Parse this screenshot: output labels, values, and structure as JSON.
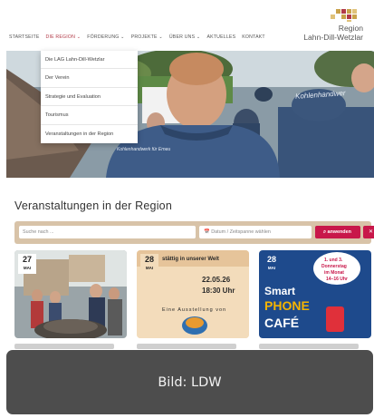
{
  "nav": {
    "items": [
      {
        "label": "STARTSEITE"
      },
      {
        "label": "DIE REGION ⌄"
      },
      {
        "label": "FÖRDERUNG ⌄"
      },
      {
        "label": "PROJEKTE ⌄"
      },
      {
        "label": "ÜBER UNS ⌄"
      },
      {
        "label": "AKTUELLES"
      },
      {
        "label": "KONTAKT"
      }
    ],
    "active": "DIE REGION",
    "accent_color": "#b23a48"
  },
  "logo": {
    "line1": "Region",
    "line2": "Lahn-Dill-Wetzlar"
  },
  "dropdown": {
    "items": [
      "Die LAG Lahn-Dill-Wetzlar",
      "Der Verein",
      "Strategie und Evaluation",
      "Tourismus",
      "Veranstaltungen in der Region"
    ]
  },
  "hero": {
    "jacket_text_1": "Kohlenhandwer",
    "jacket_text_2": "Kohlenhandwerk für Erneu"
  },
  "section": {
    "title": "Veranstaltungen in der Region"
  },
  "search": {
    "placeholder": "Suche nach ...",
    "date_placeholder": "📅 Datum / Zeitspanne wählen",
    "apply_label": "⌕ anwenden",
    "close_label": "✕",
    "bar_color": "#d8c3a8",
    "button_color": "#c8174a"
  },
  "cards": [
    {
      "day": "27",
      "month": "MAI"
    },
    {
      "day": "28",
      "month": "MAI",
      "poster": {
        "headline": "stättig in unserer Welt",
        "date": "22.05.26",
        "time": "18:30 Uhr",
        "footer": "Eine Ausstellung von"
      }
    },
    {
      "day": "28",
      "month": "MAI",
      "poster": {
        "word1": "Smart",
        "word2": "PHONE",
        "word3": "CAFÉ",
        "bubble_line1": "1. und 3.",
        "bubble_line2": "Donnerstag",
        "bubble_line3": "im Monat",
        "bubble_line4": "14–16 Uhr"
      }
    }
  ],
  "caption": {
    "text": "Bild: LDW"
  }
}
